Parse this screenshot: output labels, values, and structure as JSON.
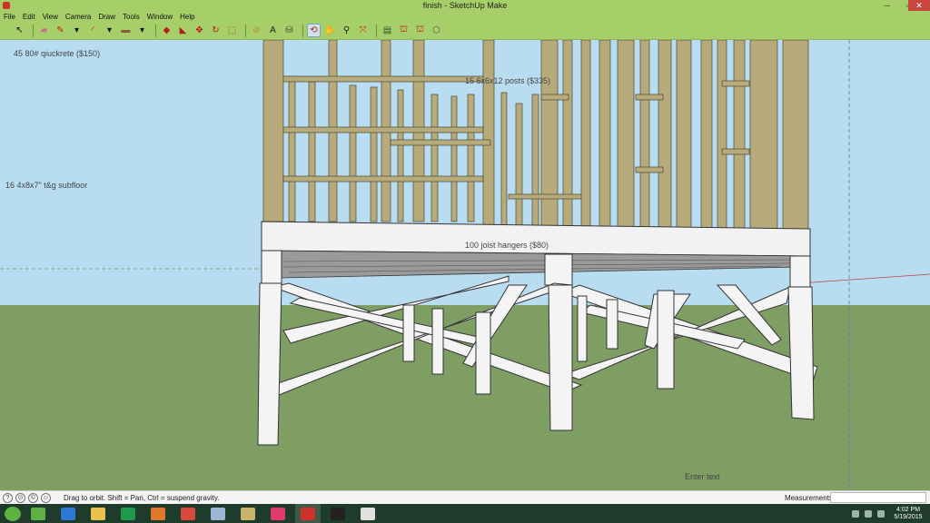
{
  "window": {
    "title": "finish - SketchUp Make",
    "minimize": "─",
    "maximize": "▫",
    "close": "✕"
  },
  "menu": [
    "File",
    "Edit",
    "View",
    "Camera",
    "Draw",
    "Tools",
    "Window",
    "Help"
  ],
  "toolbar": {
    "tools": [
      {
        "icon": "select-arrow-icon",
        "glyph": "↖",
        "color": "#111111"
      },
      {
        "icon": "eraser-icon",
        "glyph": "▰",
        "color": "#d06a8a"
      },
      {
        "icon": "pencil-line-icon",
        "glyph": "✎",
        "color": "#b71c1c"
      },
      {
        "icon": "dropdown-arrow-icon",
        "glyph": "▾",
        "color": "#111111"
      },
      {
        "icon": "arc-icon",
        "glyph": "◜",
        "color": "#b71c1c"
      },
      {
        "icon": "dropdown-arrow-icon",
        "glyph": "▾",
        "color": "#111111"
      },
      {
        "icon": "rectangle-icon",
        "glyph": "▬",
        "color": "#8a5a3a"
      },
      {
        "icon": "dropdown-arrow-icon",
        "glyph": "▾",
        "color": "#111111"
      },
      {
        "icon": "push-pull-icon",
        "glyph": "◆",
        "color": "#b71c1c"
      },
      {
        "icon": "follow-me-icon",
        "glyph": "◣",
        "color": "#b71c1c"
      },
      {
        "icon": "move-icon",
        "glyph": "✥",
        "color": "#b71c1c"
      },
      {
        "icon": "rotate-icon",
        "glyph": "↻",
        "color": "#b71c1c"
      },
      {
        "icon": "scale-icon",
        "glyph": "⬚",
        "color": "#b71c1c"
      },
      {
        "icon": "tape-measure-icon",
        "glyph": "⊘",
        "color": "#b08a22"
      },
      {
        "icon": "text-icon",
        "glyph": "A",
        "color": "#222222"
      },
      {
        "icon": "paint-bucket-icon",
        "glyph": "⛁",
        "color": "#404040"
      },
      {
        "icon": "orbit-icon",
        "glyph": "⟲",
        "color": "#c02020",
        "active": true
      },
      {
        "icon": "pan-hand-icon",
        "glyph": "✋",
        "color": "#222222"
      },
      {
        "icon": "zoom-icon",
        "glyph": "⚲",
        "color": "#222222"
      },
      {
        "icon": "zoom-extents-icon",
        "glyph": "⤧",
        "color": "#c02020"
      },
      {
        "icon": "warehouse-icon",
        "glyph": "▤",
        "color": "#305030"
      },
      {
        "icon": "share-model-icon",
        "glyph": "⛫",
        "color": "#b71c1c"
      },
      {
        "icon": "share-component-icon",
        "glyph": "⛫",
        "color": "#b71c1c"
      },
      {
        "icon": "extension-warehouse-icon",
        "glyph": "⬡",
        "color": "#555555"
      }
    ]
  },
  "annotations": [
    "45 80# qiuckrete ($150)",
    "15 6x6x12 posts ($335)",
    "16 4x8x7\" t&g subfloor",
    "100 joist hangers ($80)",
    "Enter text"
  ],
  "statusbar": {
    "hint": "Drag to orbit. Shift = Pan, Ctrl = suspend gravity.",
    "measurements_label": "Measurements",
    "measurements_value": ""
  },
  "taskbar": {
    "apps": [
      {
        "icon": "angry-birds-icon",
        "color": "#5fb142"
      },
      {
        "icon": "internet-explorer-icon",
        "color": "#2b7bd6"
      },
      {
        "icon": "file-explorer-icon",
        "color": "#e8c24a"
      },
      {
        "icon": "store-icon",
        "color": "#1f9a4a"
      },
      {
        "icon": "media-player-icon",
        "color": "#e0782a"
      },
      {
        "icon": "chrome-icon",
        "color": "#d8493c"
      },
      {
        "icon": "notepad-icon",
        "color": "#9db7d6"
      },
      {
        "icon": "game-icon",
        "color": "#c9b26a"
      },
      {
        "icon": "itunes-icon",
        "color": "#e03a6a"
      },
      {
        "icon": "sketchup-icon",
        "color": "#d0302a",
        "open": true
      },
      {
        "icon": "terminal-icon",
        "color": "#222222"
      },
      {
        "icon": "camera-icon",
        "color": "#e0e0e0"
      }
    ],
    "time": "4:02 PM",
    "date": "5/19/2015"
  }
}
